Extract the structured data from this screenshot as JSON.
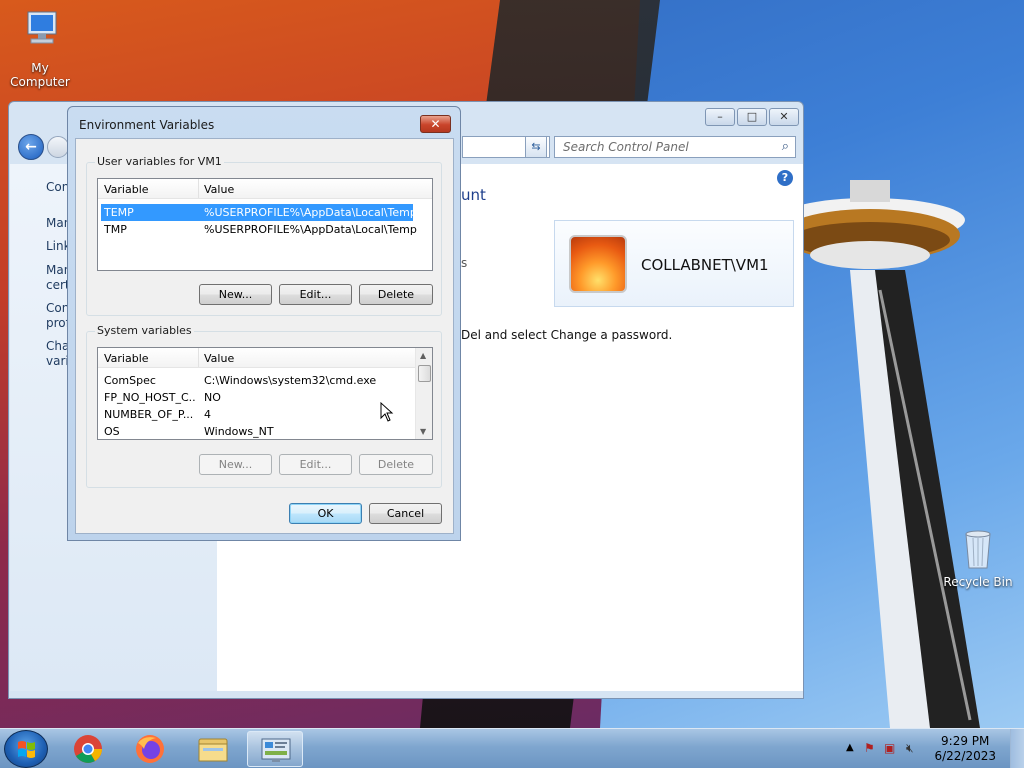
{
  "desktop": {
    "icons": [
      {
        "label": "My Computer"
      },
      {
        "label": "Recycle Bin"
      }
    ]
  },
  "control_panel": {
    "search_placeholder": "Search Control Panel",
    "window_buttons": {
      "minimize": "–",
      "maximize": "□",
      "close": "✕"
    },
    "left_links": [
      "Con",
      "Man",
      "Link",
      "Man",
      "certi",
      "Con",
      "profi",
      "Cha",
      "varia"
    ],
    "heading_fragment": "unt",
    "text_fragment": "s",
    "user_name": "COLLABNET\\VM1",
    "instruction_fragment": "Del and select Change a password."
  },
  "dialog": {
    "title": "Environment Variables",
    "close_label": "✕",
    "user_group_label": "User variables for VM1",
    "system_group_label": "System variables",
    "columns": {
      "variable": "Variable",
      "value": "Value"
    },
    "user_vars": [
      {
        "variable": "TEMP",
        "value": "%USERPROFILE%\\AppData\\Local\\Temp",
        "selected": true
      },
      {
        "variable": "TMP",
        "value": "%USERPROFILE%\\AppData\\Local\\Temp",
        "selected": false
      }
    ],
    "system_vars": [
      {
        "variable": "ComSpec",
        "value": "C:\\Windows\\system32\\cmd.exe"
      },
      {
        "variable": "FP_NO_HOST_C...",
        "value": "NO"
      },
      {
        "variable": "NUMBER_OF_P...",
        "value": "4"
      },
      {
        "variable": "OS",
        "value": "Windows_NT"
      }
    ],
    "user_buttons": {
      "new": "New...",
      "edit": "Edit...",
      "delete": "Delete"
    },
    "system_buttons": {
      "new": "New...",
      "edit": "Edit...",
      "delete": "Delete"
    },
    "ok": "OK",
    "cancel": "Cancel"
  },
  "taskbar": {
    "apps": [
      "start-button",
      "chrome",
      "firefox",
      "file-explorer",
      "control-panel"
    ],
    "active_app": "control-panel",
    "time": "9:29 PM",
    "date": "6/22/2023"
  },
  "colors": {
    "selection": "#3399ff",
    "dialog_close": "#c9442a",
    "link": "#1e3a5f"
  }
}
